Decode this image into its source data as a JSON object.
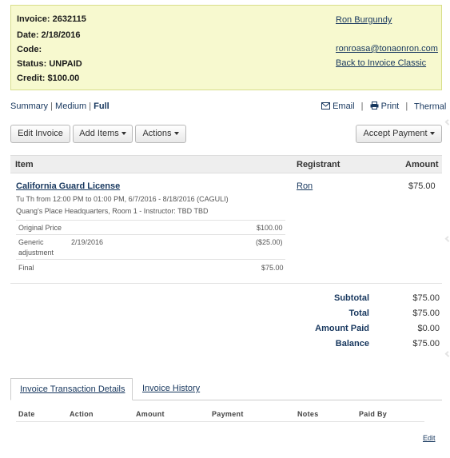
{
  "info": {
    "invoice_label": "Invoice: 2632115",
    "date_label": "Date: 2/18/2016",
    "code_label": "Code:",
    "status_label": "Status: UNPAID",
    "credit_label": "Credit: $100.00",
    "customer_name": "Ron Burgundy",
    "email": "ronroasa@tonaonron.com",
    "back_link": "Back to Invoice Classic"
  },
  "view": {
    "summary": "Summary",
    "sep1": "|",
    "medium": "Medium",
    "sep2": "|",
    "full": "Full"
  },
  "actions_bar": {
    "email": "Email",
    "sep1": "|",
    "print": "Print",
    "sep2": "|",
    "thermal": "Thermal"
  },
  "buttons": {
    "edit_invoice": "Edit Invoice",
    "add_items": "Add Items",
    "actions": "Actions",
    "accept_payment": "Accept Payment"
  },
  "items_table": {
    "col_item": "Item",
    "col_registrant": "Registrant",
    "col_amount": "Amount",
    "item_name": "California Guard License",
    "schedule": "Tu Th from 12:00 PM to 01:00 PM, 6/7/2016 - 8/18/2016 (CAGULI)",
    "location": "Quang's Place Headquarters, Room 1 - Instructor: TBD TBD",
    "registrant": "Ron",
    "amount": "$75.00",
    "breakdown": [
      {
        "label": "Original Price",
        "date": "",
        "value": "$100.00"
      },
      {
        "label": "Generic",
        "label2": "adjustment",
        "date": "2/19/2016",
        "value": "($25.00)"
      },
      {
        "label": "Final",
        "date": "",
        "value": "$75.00"
      }
    ]
  },
  "summary": {
    "subtotal_label": "Subtotal",
    "subtotal": "$75.00",
    "total_label": "Total",
    "total": "$75.00",
    "paid_label": "Amount Paid",
    "paid": "$0.00",
    "balance_label": "Balance",
    "balance": "$75.00"
  },
  "tabs": {
    "details": "Invoice Transaction Details",
    "history": "Invoice History"
  },
  "transactions": {
    "columns": [
      "Date",
      "Action",
      "Amount",
      "Payment",
      "Notes",
      "Paid By"
    ],
    "edit_link": "Edit"
  },
  "colors": {
    "link": "#17375e",
    "info_bg": "#f7f9cf",
    "info_border": "#d8de8a"
  }
}
